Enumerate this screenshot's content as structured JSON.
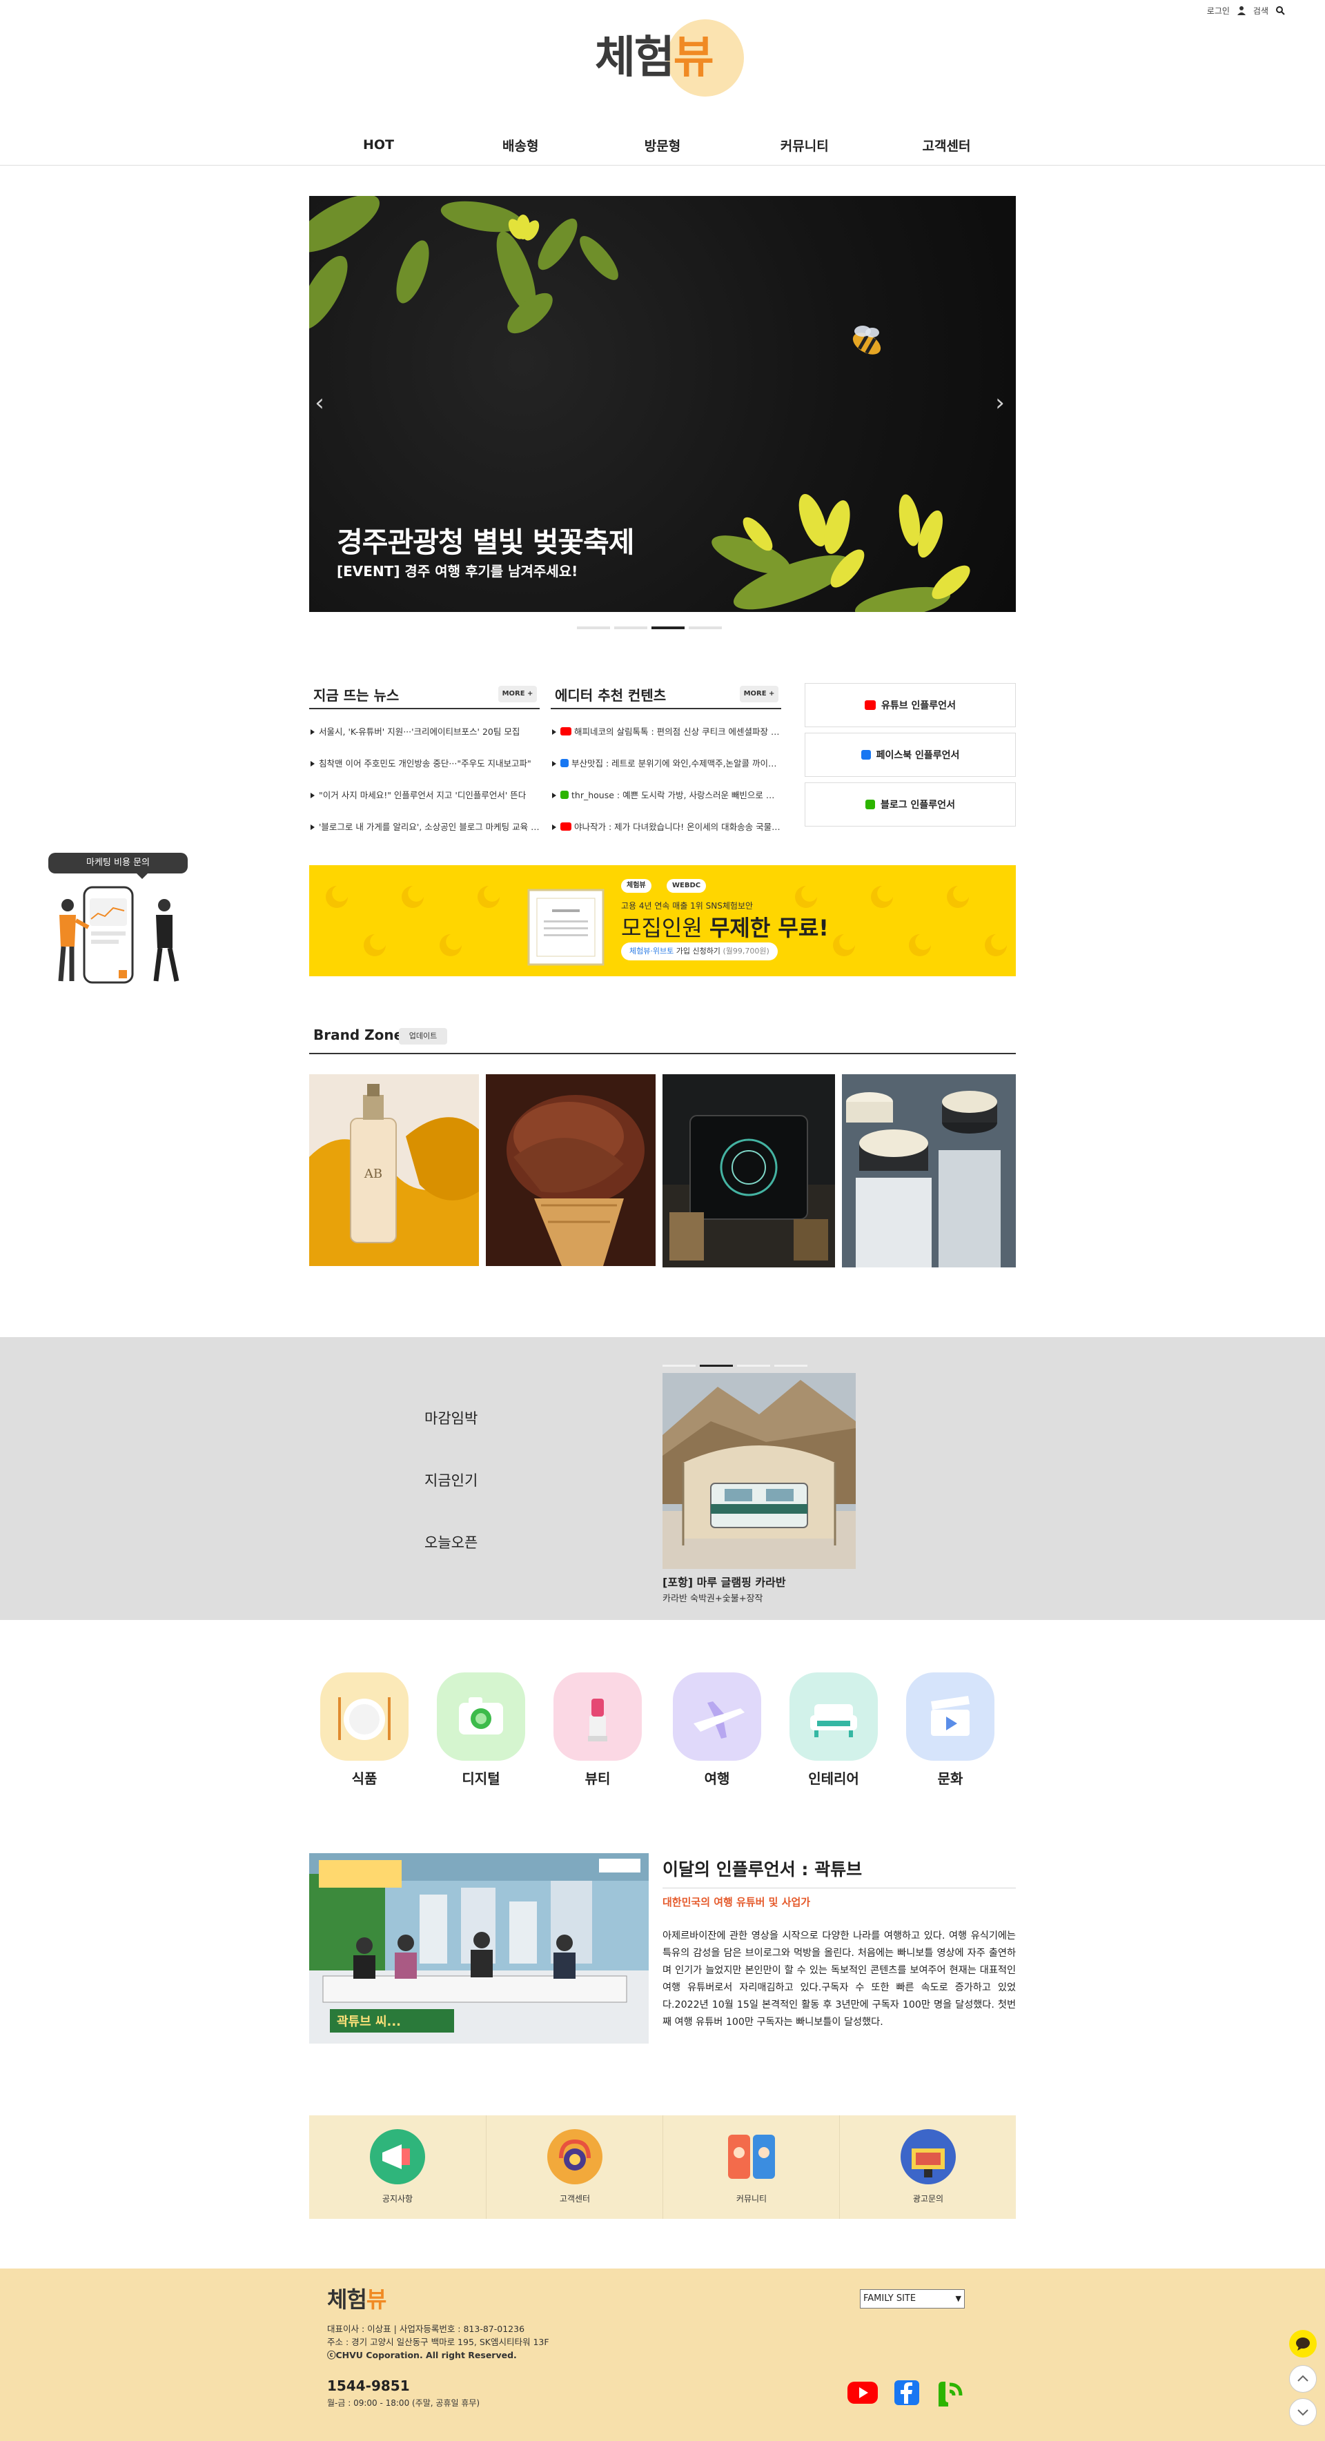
{
  "topbar": {
    "login": "로그인",
    "search": "검색"
  },
  "logo": {
    "main": "체험",
    "accent": "뷰"
  },
  "nav": [
    "HOT",
    "배송형",
    "방문형",
    "커뮤니티",
    "고객센터"
  ],
  "hero": {
    "title": "경주관광청 별빛 벚꽃축제",
    "subtitle": "[EVENT] 경주 여행 후기를 남겨주세요!",
    "slides_total": 4,
    "slide_active": 3
  },
  "news": {
    "title": "지금 뜨는 뉴스",
    "more": "MORE +",
    "items": [
      "서울시, 'K-유튜버' 지원···'크리에이티브포스' 20팀 모집",
      "침착맨 이어 주호민도 개인방송 중단···\"주우도 지내보고파\"",
      "\"이거 사지 마세요!\" 인플루언서 지고 '디인플루언서' 뜬다",
      "'블로그로 내 가게를 알리요', 소상공인 블로그 마케팅 교육 진행"
    ]
  },
  "editor": {
    "title": "에디터 추천 컨텐츠",
    "more": "MORE +",
    "items": [
      {
        "icon": "youtube-icon",
        "text": "해피네코의 살림톡톡 : 편의점 신상 쿠티크 에센셜파장 리뷰"
      },
      {
        "icon": "facebook-icon",
        "text": "부산맛집 : 레트로 분위기에 와인,수제맥주,논알콜 까이까지"
      },
      {
        "icon": "blog-icon",
        "text": "thr_house : 예쁜 도시락 가방, 사랑스러운 빼빈으로 완성"
      },
      {
        "icon": "youtube-icon",
        "text": "야나작가 : 제가 다녀왔습니다! 온이세의 대화송송 국물요리"
      }
    ]
  },
  "influencer_buttons": [
    {
      "icon": "youtube-icon",
      "label": "유튜브 인플루언서"
    },
    {
      "icon": "facebook-icon",
      "label": "페이스북 인플루언서"
    },
    {
      "icon": "blog-icon",
      "label": "블로그 인플루언서"
    }
  ],
  "side_float": {
    "label": "마케팅 비용 문의"
  },
  "banner": {
    "badge1": "체험뷰",
    "badge2": "WEBDC",
    "line1": "고용 4년 연속 매출 1위 SNS체험보안",
    "main": "모집인원",
    "main_bold": "무제한 무료!",
    "cta_a": "체험뷰·위브토",
    "cta_b": " 가입 신청하기 ",
    "cta_c": "(월99,700원)"
  },
  "brand_zone": {
    "title": "Brand Zone",
    "badge": "업데이트"
  },
  "gray_section": {
    "tabs": [
      "마감임박",
      "지금인기",
      "오늘오픈"
    ],
    "card_title": "[포항] 마루 글램핑 카라반",
    "card_sub": "카라반 숙박권+숯불+장작",
    "slides_total": 4,
    "slide_active": 2
  },
  "categories": [
    {
      "label": "식품",
      "icon": "plate-icon",
      "bg": "#fbe9b8"
    },
    {
      "label": "디지털",
      "icon": "camera-icon",
      "bg": "#d5f5cf"
    },
    {
      "label": "뷰티",
      "icon": "lipstick-icon",
      "bg": "#fbd8e4"
    },
    {
      "label": "여행",
      "icon": "airplane-icon",
      "bg": "#e0d9fa"
    },
    {
      "label": "인테리어",
      "icon": "sofa-icon",
      "bg": "#d2f2ea"
    },
    {
      "label": "문화",
      "icon": "clapper-icon",
      "bg": "#d6e4fb"
    }
  ],
  "influencer_month": {
    "title": "이달의 인플루언서 : 곽튜브",
    "subtitle": "대한민국의 여행 유튜버 및 사업가",
    "body": " 아제르바이잔에 관한 영상을 시작으로 다양한 나라를 여행하고 있다. 여행 유식기에는 특유의 감성을 담은 브이로그와 먹방을 올린다. 처음에는 빠니보틀 영상에 자주 출연하며 인기가 늘었지만 본인만이 할 수 있는 독보적인 콘텐츠를 보여주어 현재는 대표적인 여행 유튜버로서 자리매김하고 있다.구독자 수 또한 빠른 속도로 증가하고 있었다.2022년 10월 15일 본격적인 활동 후 3년만에 구독자 100만 명을 달성했다. 첫번째 여행 유튜버 100만 구독자는 빠니보틀이 달성했다.",
    "caption": "곽튜브 씨..."
  },
  "quick_menu": [
    {
      "label": "공지사항",
      "icon": "megaphone-icon"
    },
    {
      "label": "고객센터",
      "icon": "headset-icon"
    },
    {
      "label": "커뮤니티",
      "icon": "community-icon"
    },
    {
      "label": "광고문의",
      "icon": "ad-icon"
    }
  ],
  "footer": {
    "logo_main": "체험",
    "logo_accent": "뷰",
    "info1": "대표이사 : 이상표 | 사업자등록번호 : 813-87-01236",
    "info2": "주소 : 경기 고양시 일산동구 백마로 195, SK엠시티타워 13F",
    "info3": "ⓒCHVU Coporation. All right Reserved.",
    "phone": "1544-9851",
    "hours": "월-금 : 09:00 - 18:00  (주말, 공휴일 휴무)",
    "family_site": "FAMILY SITE"
  },
  "colors": {
    "accent": "#f08a24",
    "banner_yellow": "#ffd600",
    "youtube": "#ff0000",
    "facebook": "#1877f2",
    "blog": "#2db400",
    "footer_bg": "#f7e0ab"
  }
}
